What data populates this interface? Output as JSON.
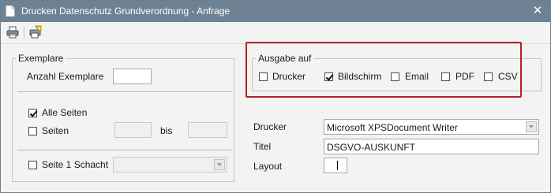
{
  "window": {
    "title": "Drucken Datenschutz Grundverordnung - Anfrage",
    "close_symbol": "✕"
  },
  "toolbar": {
    "print_icon": "printer-icon",
    "settings_icon": "printer-settings-icon"
  },
  "exemplare": {
    "legend": "Exemplare",
    "count_label": "Anzahl Exemplare",
    "count_value": "",
    "all_pages_label": "Alle Seiten",
    "all_pages_checked": true,
    "pages_label": "Seiten",
    "pages_from": "",
    "pages_to_label": "bis",
    "pages_to": "",
    "tray_label": "Seite 1 Schacht",
    "tray_checked": false,
    "tray_value": ""
  },
  "ausgabe": {
    "legend": "Ausgabe auf",
    "options": [
      {
        "label": "Drucker",
        "checked": false
      },
      {
        "label": "Bildschirm",
        "checked": true
      },
      {
        "label": "Email",
        "checked": false
      },
      {
        "label": "PDF",
        "checked": false
      },
      {
        "label": "CSV",
        "checked": false
      }
    ]
  },
  "settings": {
    "printer_label": "Drucker",
    "printer_value": "Microsoft XPSDocument Writer",
    "title_label": "Titel",
    "title_value": "DSGVO-AUSKUNFT",
    "layout_label": "Layout",
    "layout_value": ""
  },
  "colors": {
    "titlebar": "#6f8294",
    "highlight": "#b0222a",
    "background": "#f3f3f3"
  }
}
